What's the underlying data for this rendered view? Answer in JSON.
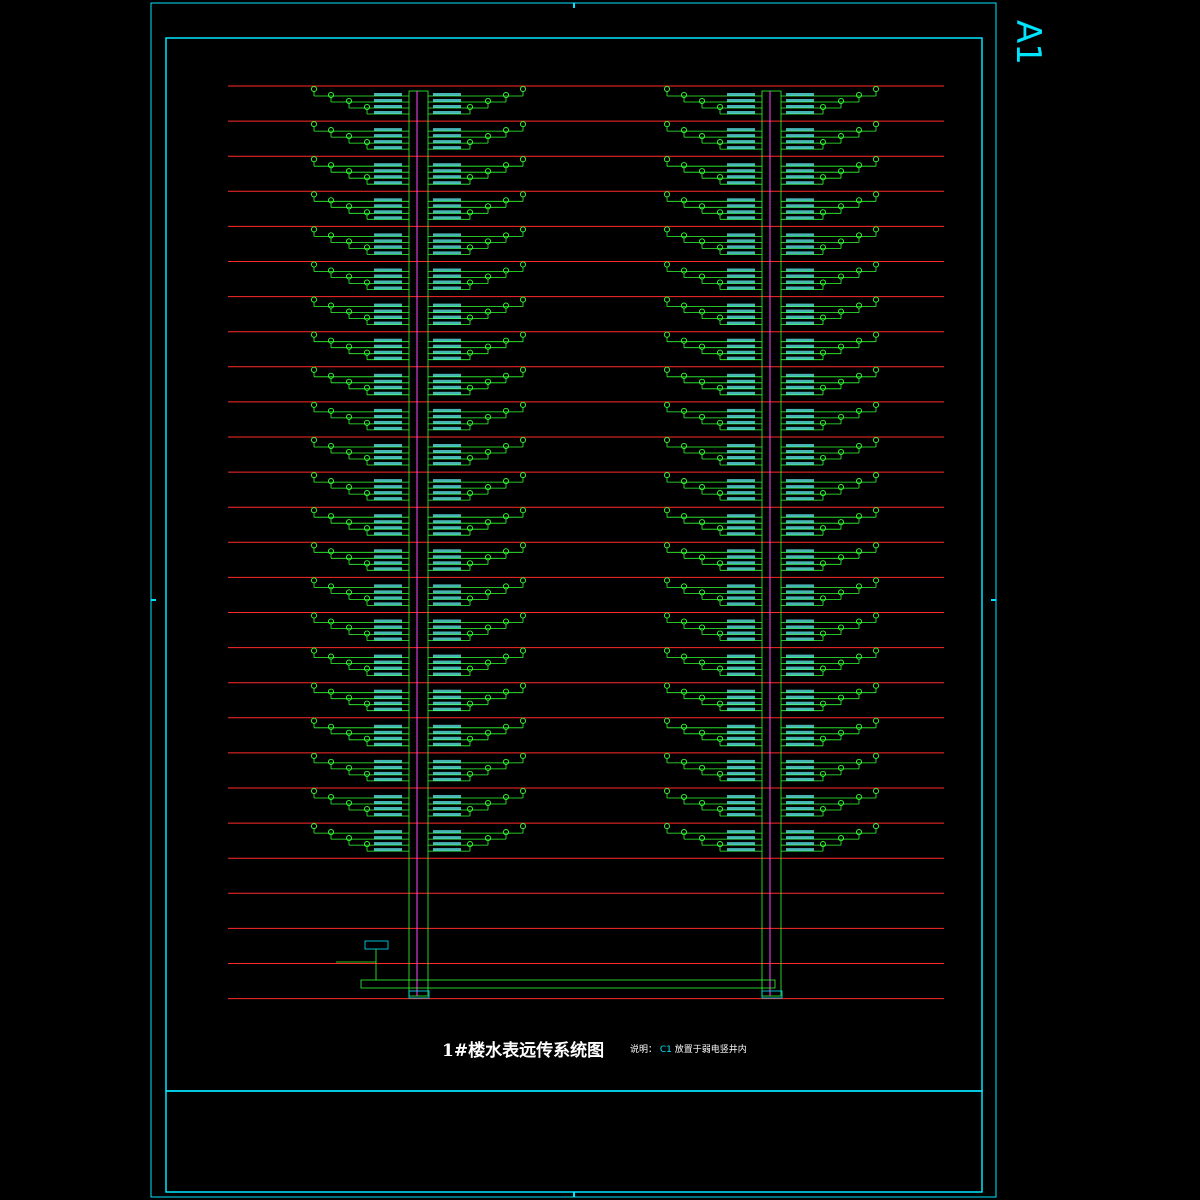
{
  "sheet": {
    "size_label": "A1",
    "title": "1#楼水表远传系统图",
    "note_prefix": "说明：",
    "note_box": "C1",
    "note_text": "放置于弱电竖井内"
  },
  "colors": {
    "frame": "#00e5ff",
    "floor_line": "#ff2a2a",
    "branch": "#33ff33",
    "riser": "#ff44ff",
    "text": "#ffffff",
    "label": "#66ffff"
  },
  "diagram": {
    "floor_count": 27,
    "metered_floor_count": 22,
    "riser_count": 2,
    "units_per_floor_side": 4
  }
}
